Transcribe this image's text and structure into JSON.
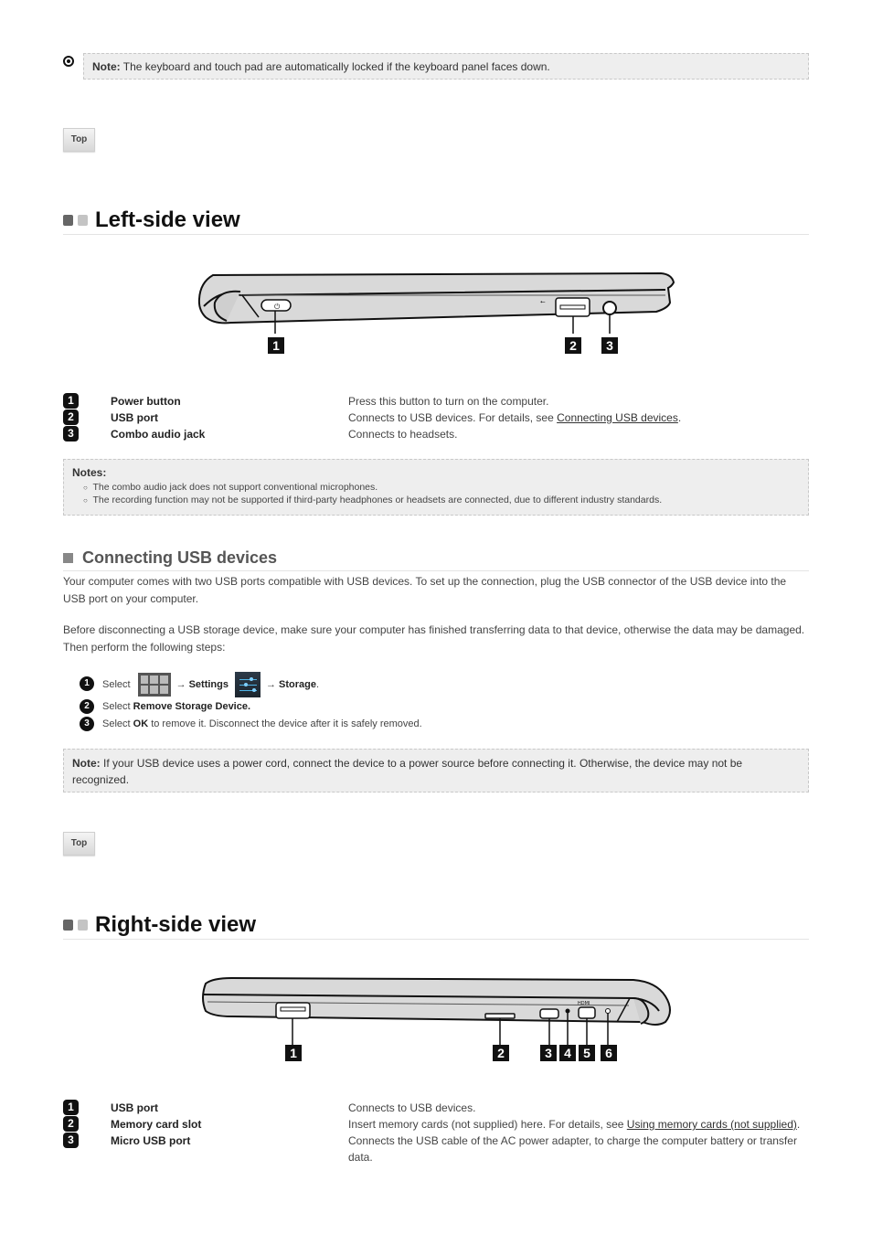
{
  "top_note": {
    "icon": "radio-bullet-icon",
    "label": "Note:",
    "text": "The keyboard and touch pad are automatically locked if the keyboard panel faces down."
  },
  "top_button_label": "Top",
  "left_view": {
    "title": "Left-side view",
    "callouts": [
      "1",
      "2",
      "3"
    ],
    "items": [
      {
        "num": "1",
        "label": "Power button",
        "desc": "Press this button to turn on the computer.",
        "link": ""
      },
      {
        "num": "2",
        "label": "USB port",
        "desc": "Connects to USB devices. For details, see ",
        "link": "Connecting USB devices",
        "after": "."
      },
      {
        "num": "3",
        "label": "Combo audio jack",
        "desc": "Connects to headsets.",
        "link": ""
      }
    ],
    "notes": {
      "title": "Notes:",
      "items": [
        "The combo audio jack does not support conventional microphones.",
        "The recording function may not be supported if third-party headphones or headsets are connected, due to different industry standards."
      ]
    }
  },
  "usb_section": {
    "title": "Connecting USB devices",
    "para1": "Your computer comes with two USB ports compatible with USB devices. To set up the connection, plug the USB connector of the USB device into the USB port on your computer.",
    "para2": "Before disconnecting a USB storage device, make sure your computer has finished transferring data to that device, otherwise the data may be damaged. Then perform the following steps:",
    "steps": [
      {
        "num": "1",
        "pre": "Select",
        "arrow1": "→",
        "bold1": "Settings",
        "arrow2": "→",
        "bold2": "Storage",
        "post": "."
      },
      {
        "num": "2",
        "pre": "Select ",
        "bold": "Remove Storage Device.",
        "post": ""
      },
      {
        "num": "3",
        "pre": "Select ",
        "bold": "OK",
        "post": " to remove it. Disconnect the device after it is safely removed."
      }
    ],
    "note": {
      "label": "Note:",
      "text": "If your USB device uses a power cord, connect the device to a power source before connecting it. Otherwise, the device may not be recognized."
    }
  },
  "right_view": {
    "title": "Right-side view",
    "callouts": [
      "1",
      "2",
      "3",
      "4",
      "5",
      "6"
    ],
    "port_labels": {
      "hdmi": "HDMI"
    },
    "items": [
      {
        "num": "1",
        "label": "USB port",
        "desc": "Connects to USB devices.",
        "link": ""
      },
      {
        "num": "2",
        "label": "Memory card slot",
        "desc": "Insert memory cards (not supplied) here. For details, see ",
        "link": "Using memory cards (not supplied)",
        "after": "."
      },
      {
        "num": "3",
        "label": "Micro USB port",
        "desc": "Connects the USB cable of the AC power adapter, to charge the computer battery or transfer data.",
        "link": ""
      }
    ]
  }
}
